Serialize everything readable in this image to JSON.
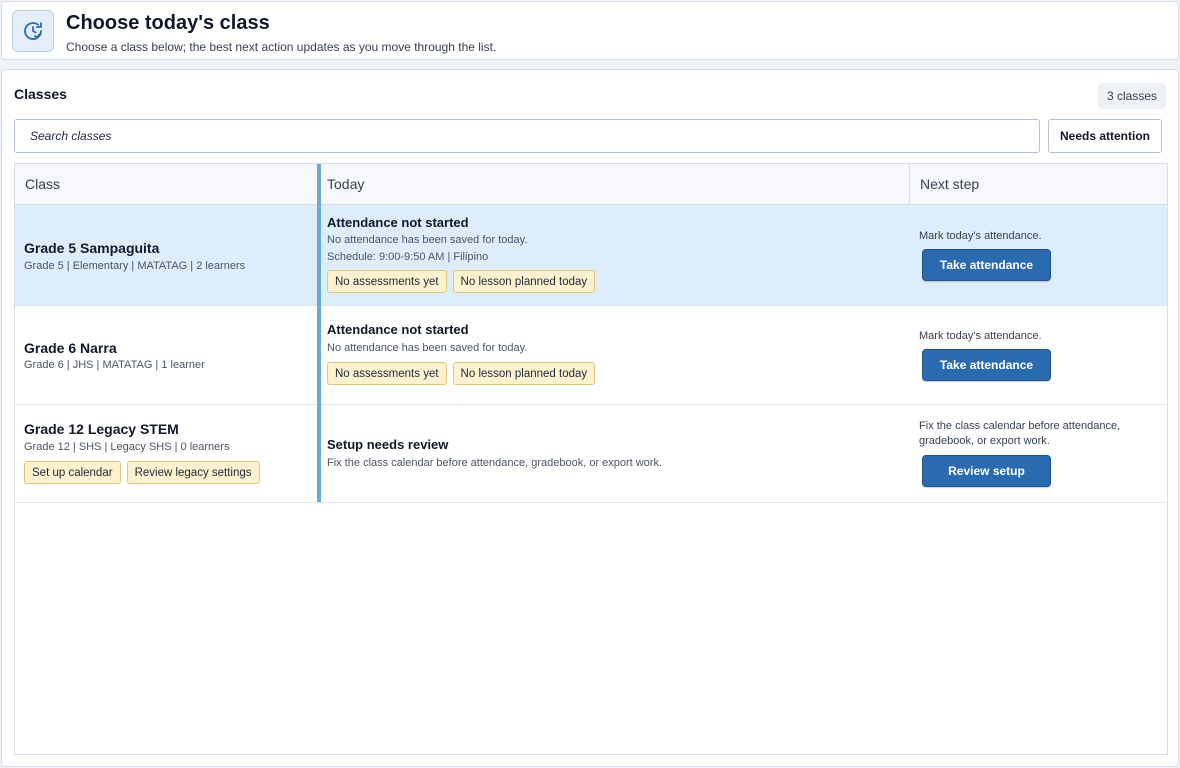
{
  "header": {
    "title": "Choose today's class",
    "subtitle": "Choose a class below; the best next action updates as you move through the list.",
    "icon": "clock-check-icon"
  },
  "classes_section": {
    "title": "Classes",
    "count_label": "3 classes",
    "search_placeholder": "Search classes",
    "filter_label": "Needs attention",
    "columns": [
      "Class",
      "Today",
      "Next step"
    ]
  },
  "rows": [
    {
      "name": "Grade 5 Sampaguita",
      "meta": "Grade 5 | Elementary | MATATAG | 2 learners",
      "class_tags": [],
      "today_title": "Attendance not started",
      "today_lines": [
        "No attendance has been saved for today.",
        "Schedule: 9:00-9:50 AM | Filipino"
      ],
      "today_tags": [
        "No assessments yet",
        "No lesson planned today"
      ],
      "next_text": "Mark today's attendance.",
      "action_label": "Take attendance",
      "selected": true
    },
    {
      "name": "Grade 6 Narra",
      "meta": "Grade 6 | JHS | MATATAG | 1 learner",
      "class_tags": [],
      "today_title": "Attendance not started",
      "today_lines": [
        "No attendance has been saved for today."
      ],
      "today_tags": [
        "No assessments yet",
        "No lesson planned today"
      ],
      "next_text": "Mark today's attendance.",
      "action_label": "Take attendance",
      "selected": false
    },
    {
      "name": "Grade 12 Legacy STEM",
      "meta": "Grade 12 | SHS | Legacy SHS | 0 learners",
      "class_tags": [
        "Set up calendar",
        "Review legacy settings"
      ],
      "today_title": "Setup needs review",
      "today_lines": [
        "Fix the class calendar before attendance, gradebook, or export work."
      ],
      "today_tags": [],
      "next_text": "Fix the class calendar before attendance, gradebook, or export work.",
      "action_label": "Review setup",
      "selected": false
    }
  ],
  "colors": {
    "accent": "#2a6aae",
    "selected_row": "#deedfc",
    "tag_bg": "#fdf2d0",
    "tag_border": "#e3c779",
    "accent_bar": "#6aaad9"
  }
}
